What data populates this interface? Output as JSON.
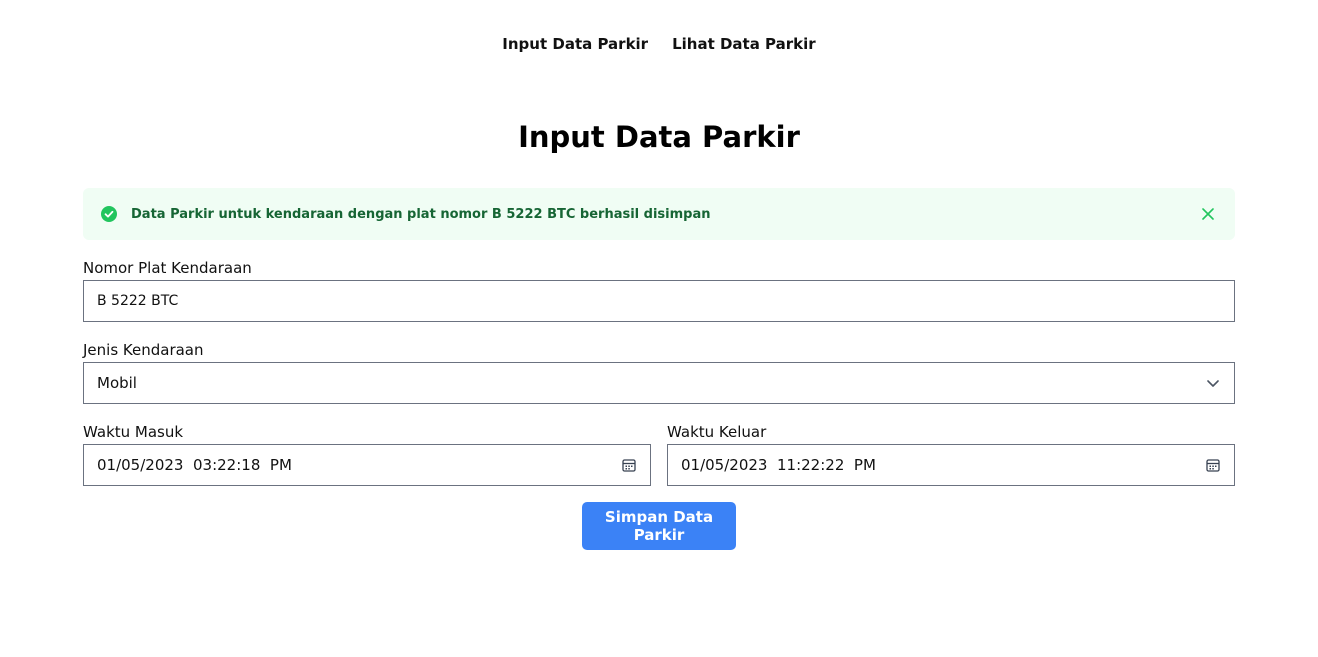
{
  "nav": {
    "items": [
      {
        "label": "Input Data Parkir"
      },
      {
        "label": "Lihat Data Parkir"
      }
    ]
  },
  "page": {
    "title": "Input Data Parkir"
  },
  "alert": {
    "message": "Data Parkir untuk kendaraan dengan plat nomor B 5222 BTC berhasil disimpan",
    "icon": "check-circle-icon",
    "close_icon": "close-icon",
    "color": "#22c55e"
  },
  "form": {
    "plate_label": "Nomor Plat Kendaraan",
    "plate_value": "B 5222 BTC",
    "type_label": "Jenis Kendaraan",
    "type_value": "Mobil",
    "in_label": "Waktu Masuk",
    "in_value": "01/05/2023  03:22:18  PM",
    "out_label": "Waktu Keluar",
    "out_value": "01/05/2023  11:22:22  PM",
    "submit_label": "Simpan Data Parkir"
  },
  "colors": {
    "accent": "#3b82f6",
    "alert_bg": "#f0fdf4",
    "alert_text": "#166534"
  }
}
